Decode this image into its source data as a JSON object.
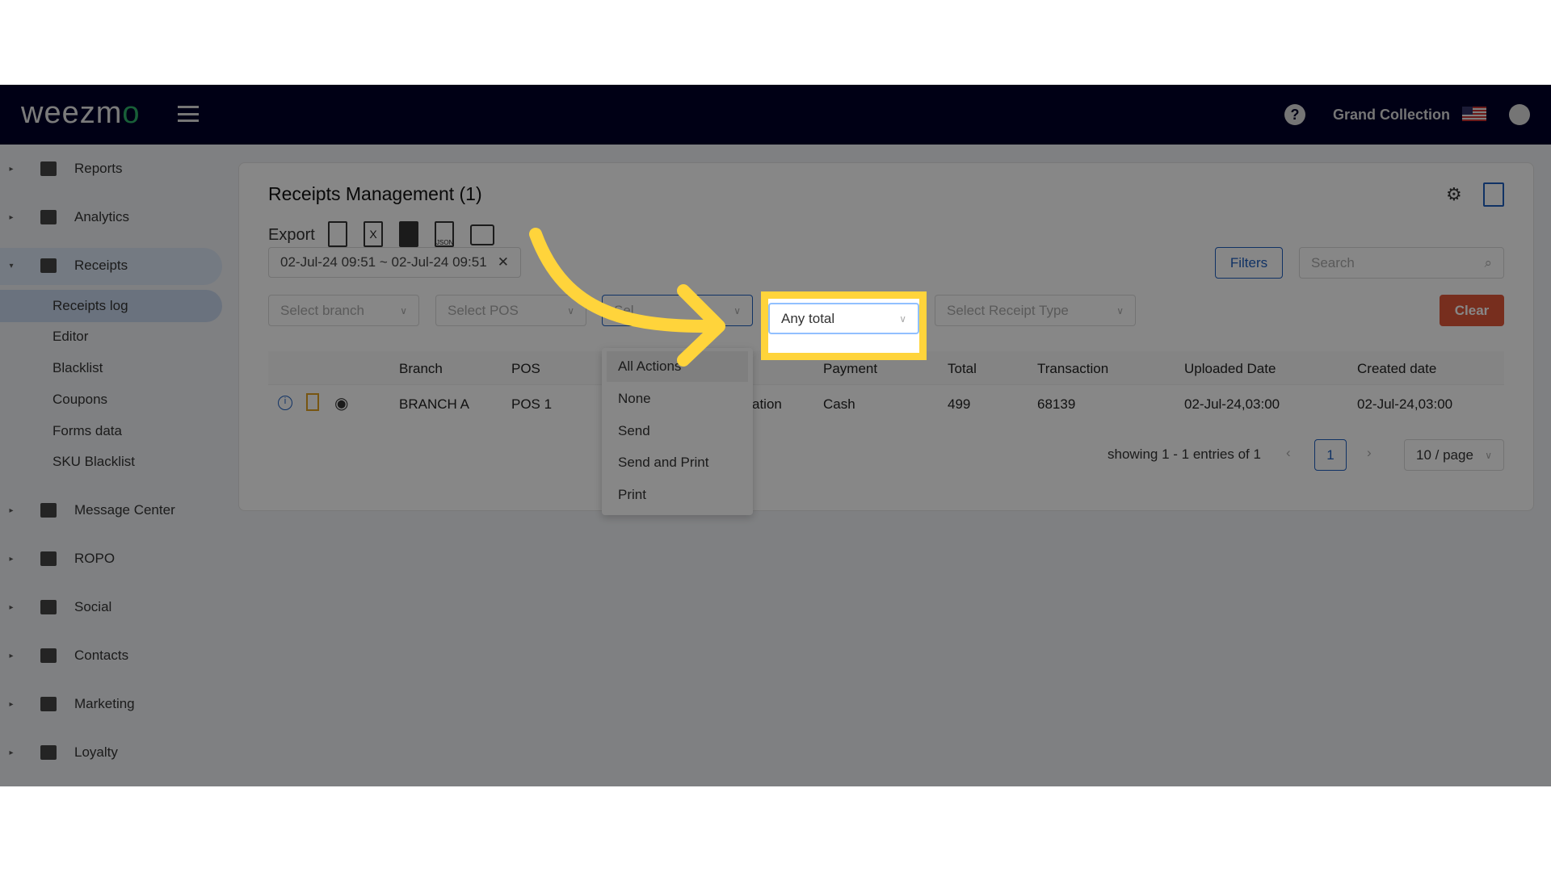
{
  "header": {
    "logo": "weezmo",
    "org": "Grand Collection"
  },
  "sidebar": {
    "items": [
      {
        "label": "Reports",
        "icon": "dashboard-icon"
      },
      {
        "label": "Analytics",
        "icon": "chart-icon"
      },
      {
        "label": "Receipts",
        "icon": "receipt-icon",
        "expanded": true,
        "sub": [
          "Receipts log",
          "Editor",
          "Blacklist",
          "Coupons",
          "Forms data",
          "SKU Blacklist"
        ]
      },
      {
        "label": "Message Center",
        "icon": "message-icon"
      },
      {
        "label": "ROPO",
        "icon": "infinity-icon"
      },
      {
        "label": "Social",
        "icon": "users-icon"
      },
      {
        "label": "Contacts",
        "icon": "contacts-icon"
      },
      {
        "label": "Marketing",
        "icon": "megaphone-icon"
      },
      {
        "label": "Loyalty",
        "icon": "tag-icon"
      }
    ],
    "active": "Receipts log"
  },
  "page": {
    "title": "Receipts Management (1)",
    "export_label": "Export",
    "json_label": "JSON",
    "date_range": "02-Jul-24 09:51 ~ 02-Jul-24 09:51",
    "filters": "Filters",
    "search_placeholder": "Search",
    "selects": {
      "branch": "Select branch",
      "pos": "Select POS",
      "action": "Sel",
      "total": "Any total",
      "receipt_type": "Select Receipt Type"
    },
    "clear": "Clear"
  },
  "dropdown": {
    "options": [
      "All Actions",
      "None",
      "Send",
      "Send and Print",
      "Print"
    ],
    "hovered": "All Actions"
  },
  "table": {
    "columns": [
      "Branch",
      "POS",
      "Payment",
      "Total",
      "Transaction",
      "Uploaded Date",
      "Created date"
    ],
    "rows": [
      {
        "branch": "BRANCH A",
        "pos": "POS 1",
        "action_partial": "ation",
        "payment": "Cash",
        "total": "499",
        "transaction": "68139",
        "uploaded": "02-Jul-24,03:00",
        "created": "02-Jul-24,03:00"
      }
    ]
  },
  "pagination": {
    "showing": "showing 1 - 1 entries of 1",
    "page": "1",
    "per_page": "10 / page"
  },
  "colors": {
    "nav": "#000028",
    "accent": "#1f5fbf",
    "clear": "#e0573a",
    "highlight": "#ffd43b"
  }
}
